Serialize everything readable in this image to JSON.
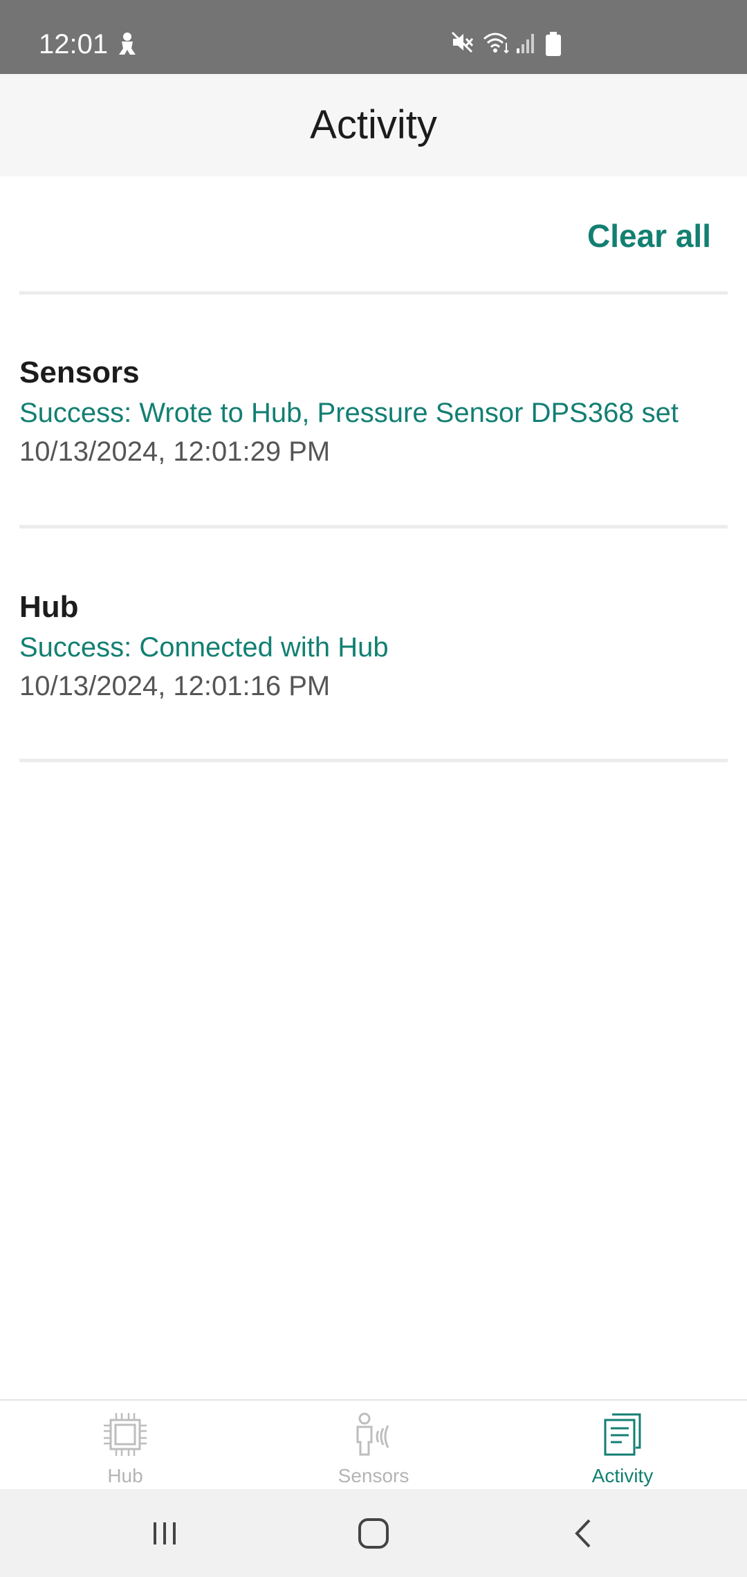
{
  "status_bar": {
    "time": "12:01",
    "icons": [
      "person-notification-icon",
      "mute-icon",
      "wifi-icon",
      "signal-icon",
      "battery-icon"
    ]
  },
  "header": {
    "title": "Activity"
  },
  "actions": {
    "clear_all_label": "Clear all"
  },
  "activity": [
    {
      "category": "Sensors",
      "message": "Success: Wrote to Hub, Pressure Sensor DPS368 set",
      "timestamp": "10/13/2024, 12:01:29 PM"
    },
    {
      "category": "Hub",
      "message": "Success: Connected with Hub",
      "timestamp": "10/13/2024, 12:01:16 PM"
    }
  ],
  "tabs": [
    {
      "label": "Hub",
      "icon": "chip-icon",
      "active": false
    },
    {
      "label": "Sensors",
      "icon": "person-sensor-icon",
      "active": false
    },
    {
      "label": "Activity",
      "icon": "document-icon",
      "active": true
    }
  ],
  "colors": {
    "accent": "#127f72",
    "status_bar": "#747474",
    "header_bg": "#f6f6f6",
    "inactive_tab": "#b4b4b4"
  },
  "system_nav": [
    "recents-icon",
    "home-icon",
    "back-icon"
  ]
}
